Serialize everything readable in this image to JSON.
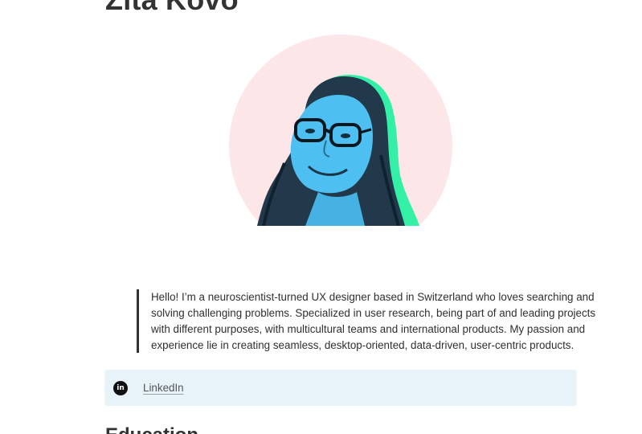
{
  "profile": {
    "name": "Zita Kovó",
    "bio": "Hello! I’m a neuroscientist-turned UX designer based in Switzerland who loves searching and solving challenging problems. Specialized in user research, being part of and leading projects with different purposes, with multicultural teams and international products. My passion and experience lie in creating seamless, desktop-oriented, data-driven, user-centric products."
  },
  "links": {
    "linkedin_icon_text": "in",
    "linkedin_label": "LinkedIn"
  },
  "sections": {
    "education_title": "Education"
  },
  "colors": {
    "portrait_background": "#fde6e8",
    "portrait_face": "#4dbff0",
    "portrait_accent": "#33f0a6",
    "link_box_background": "#e7f3f8"
  }
}
